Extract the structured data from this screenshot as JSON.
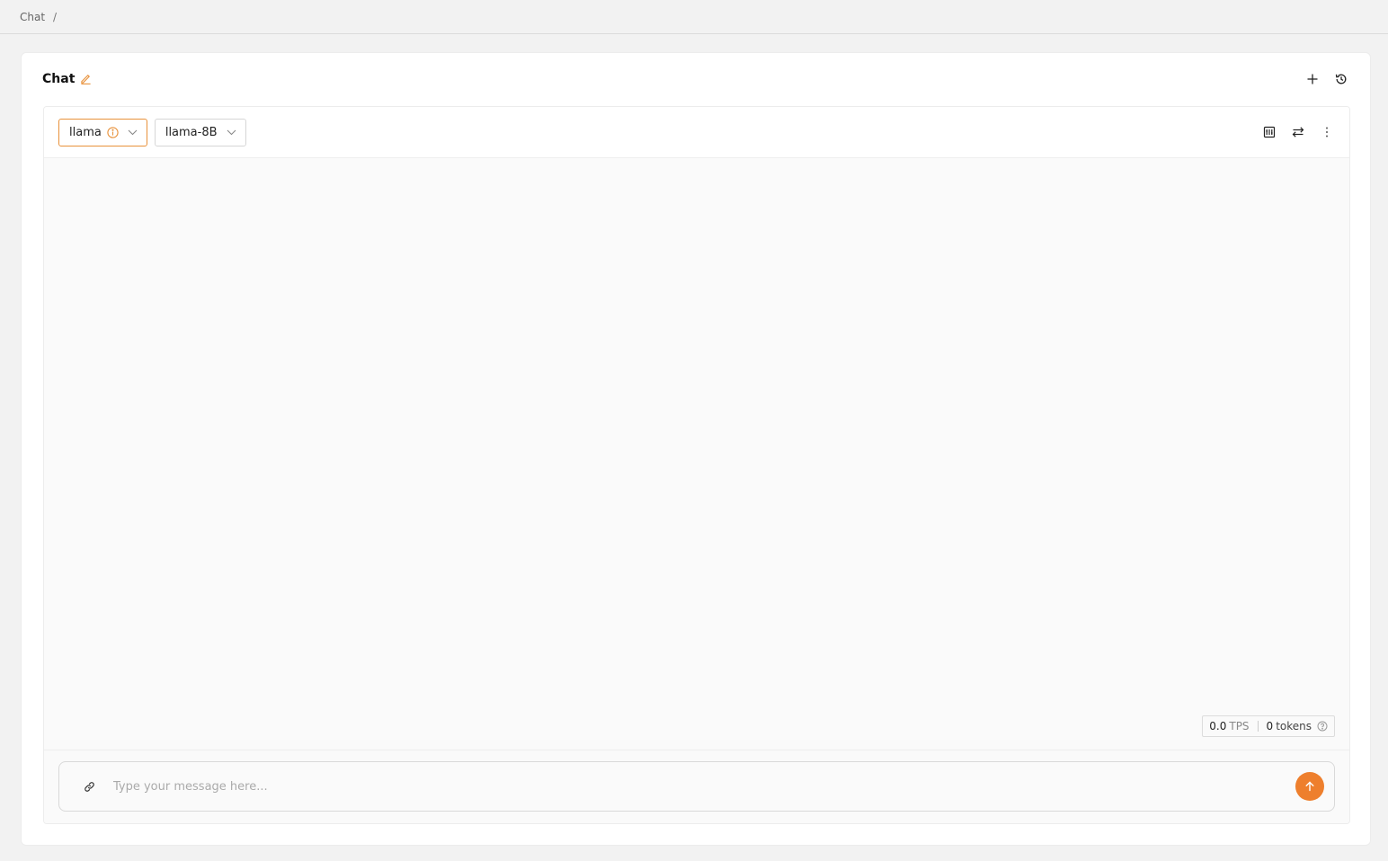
{
  "breadcrumb": {
    "item": "Chat",
    "separator": "/"
  },
  "card": {
    "title": "Chat"
  },
  "header_actions": {
    "new_icon": "plus-icon",
    "history_icon": "history-icon"
  },
  "model_provider": {
    "value": "llama",
    "icon": "info-icon"
  },
  "model_name": {
    "value": "llama-8B"
  },
  "toolbar_icons": [
    "compare-panel-icon",
    "swap-icon",
    "more-vertical-icon"
  ],
  "stats": {
    "tps_value": "0.0",
    "tps_unit": "TPS",
    "tokens_value": "0",
    "tokens_unit": "tokens"
  },
  "composer": {
    "placeholder": "Type your message here...",
    "value": ""
  },
  "colors": {
    "accent": "#ee7f2d",
    "background": "#f2f2f2",
    "panel": "#fafafa"
  }
}
